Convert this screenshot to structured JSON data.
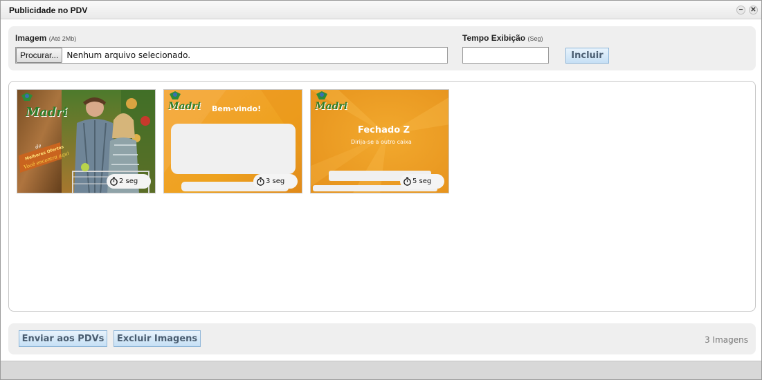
{
  "window": {
    "title": "Publicidade no PDV",
    "minimize_symbol": "−",
    "close_symbol": "✕"
  },
  "upload": {
    "image_label": "Imagem",
    "image_hint": "(Até 2Mb)",
    "browse_label": "Procurar...",
    "file_status": "Nenhum arquivo selecionado.",
    "time_label": "Tempo Exibição",
    "time_hint": "(Seg)",
    "time_value": "",
    "include_label": "Incluir"
  },
  "gallery": {
    "images": [
      {
        "brand": "Madri",
        "tag_line1": "de",
        "tag_line2": "Melhores Ofertas",
        "tag_line3": "Você encontra aqui",
        "duration": "2 seg"
      },
      {
        "brand": "Madri",
        "heading": "Bem-vindo!",
        "duration": "3 seg"
      },
      {
        "brand": "Madri",
        "heading": "Fechado Z",
        "subheading": "Dirija-se a outro caixa",
        "duration": "5 seg"
      }
    ]
  },
  "footer": {
    "send_label": "Enviar aos PDVs",
    "delete_label": "Excluir Imagens",
    "count_label": "3 Imagens"
  },
  "colors": {
    "accent_button": "#c6e0f5",
    "orange_slide": "#f29a1c",
    "brand_green": "#2f7d2a"
  }
}
